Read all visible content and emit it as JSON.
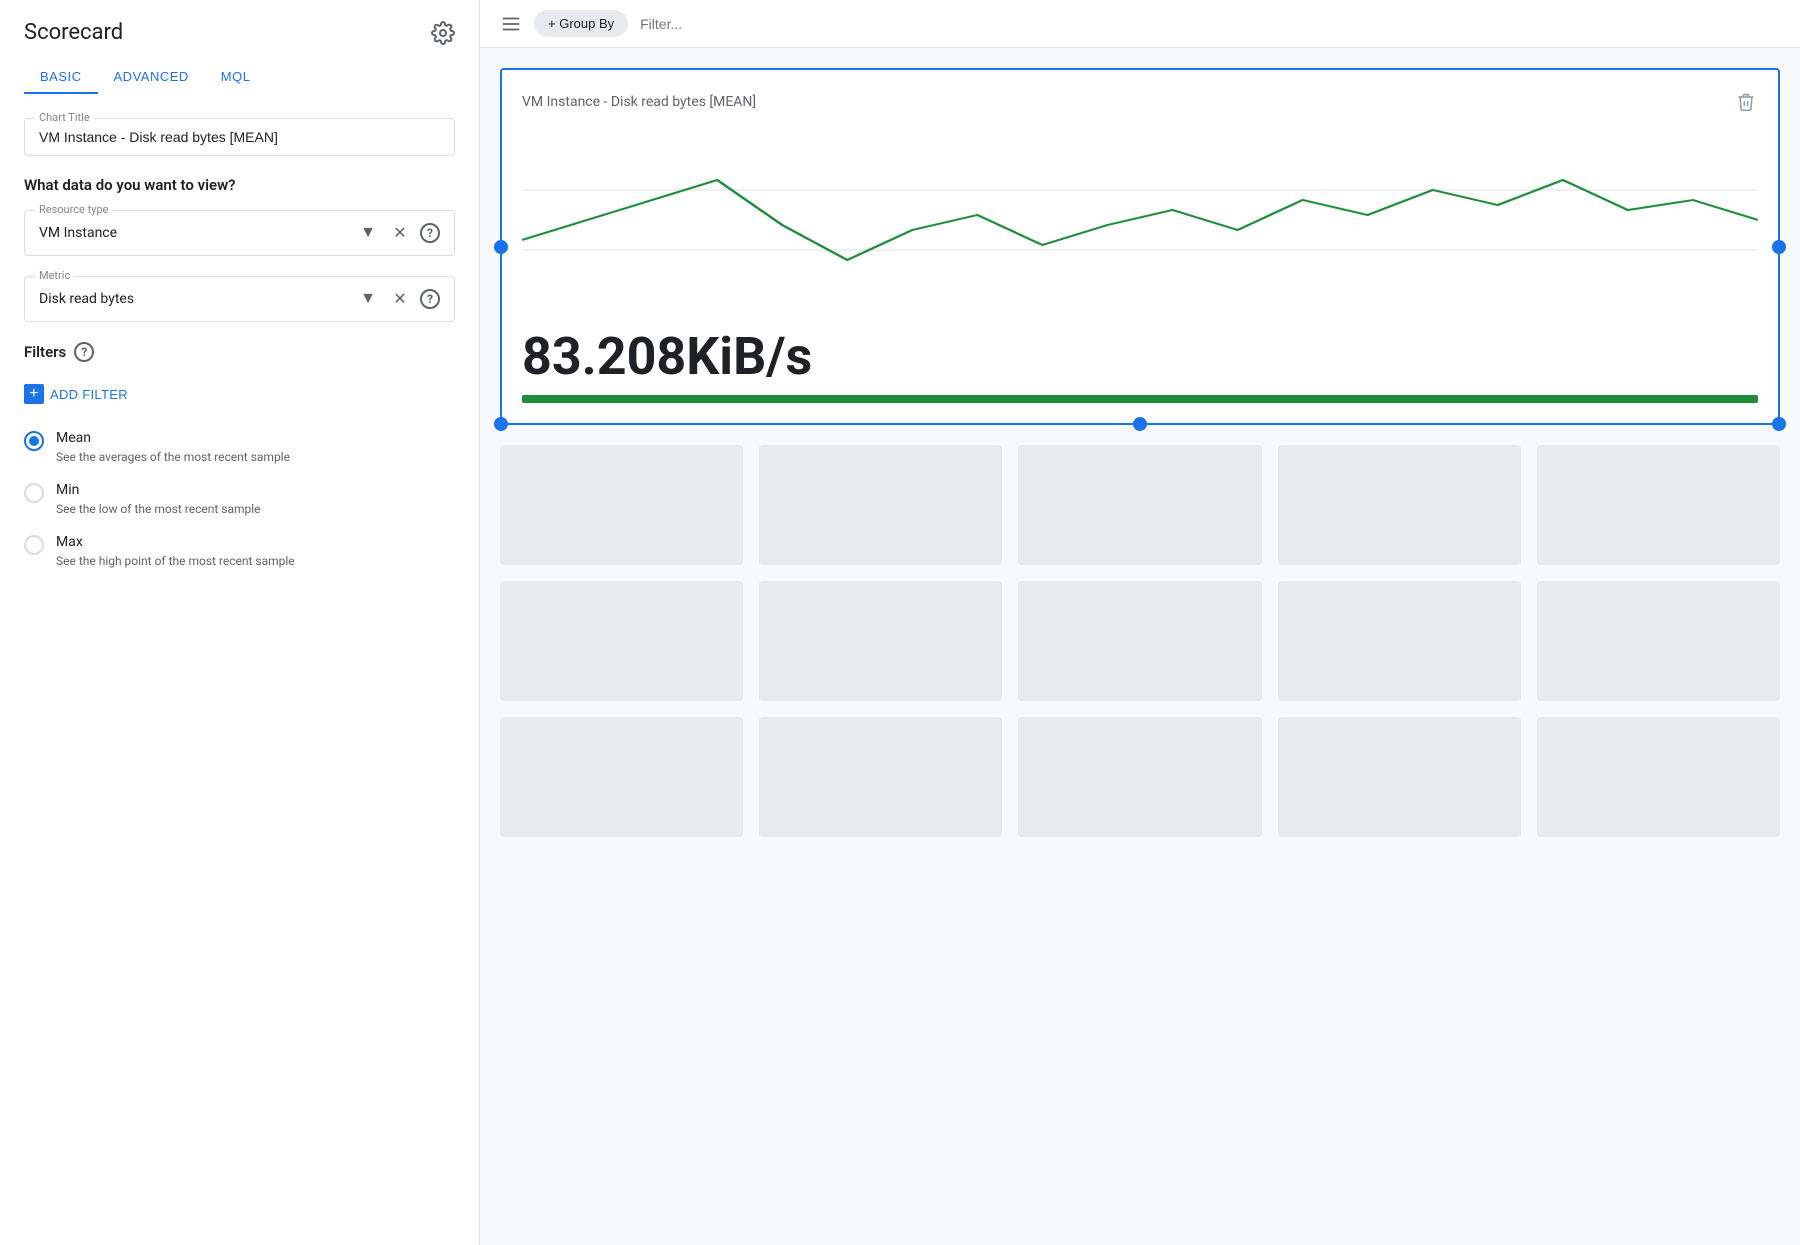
{
  "panel": {
    "title": "Scorecard",
    "tabs": [
      {
        "id": "basic",
        "label": "BASIC",
        "active": true
      },
      {
        "id": "advanced",
        "label": "ADVANCED",
        "active": false
      },
      {
        "id": "mql",
        "label": "MQL",
        "active": false
      }
    ],
    "chart_title_label": "Chart Title",
    "chart_title_value": "VM Instance - Disk read bytes [MEAN]",
    "what_data_label": "What data do you want to view?",
    "resource_type_label": "Resource type",
    "resource_type_value": "VM Instance",
    "metric_label": "Metric",
    "metric_value": "Disk read bytes",
    "filters_label": "Filters",
    "add_filter_label": "ADD FILTER",
    "radio_options": [
      {
        "id": "mean",
        "label": "Mean",
        "description": "See the averages of the most recent sample",
        "checked": true
      },
      {
        "id": "min",
        "label": "Min",
        "description": "See the low of the most recent sample",
        "checked": false
      },
      {
        "id": "max",
        "label": "Max",
        "description": "See the high point of the most recent sample",
        "checked": false
      }
    ]
  },
  "toolbar": {
    "group_by_label": "+ Group By",
    "filter_placeholder": "Filter..."
  },
  "chart": {
    "title": "VM Instance - Disk read bytes [MEAN]",
    "value": "83.208KiB/s",
    "line_color": "#1e8e3e",
    "bar_color": "#1e8e3e"
  },
  "placeholder_rows": [
    {
      "count": 5
    },
    {
      "count": 5
    },
    {
      "count": 5
    }
  ],
  "icons": {
    "gear": "⚙",
    "filter_lines": "≡",
    "dropdown_arrow": "▼",
    "close_x": "✕",
    "help_q": "?",
    "delete": "🗑"
  }
}
